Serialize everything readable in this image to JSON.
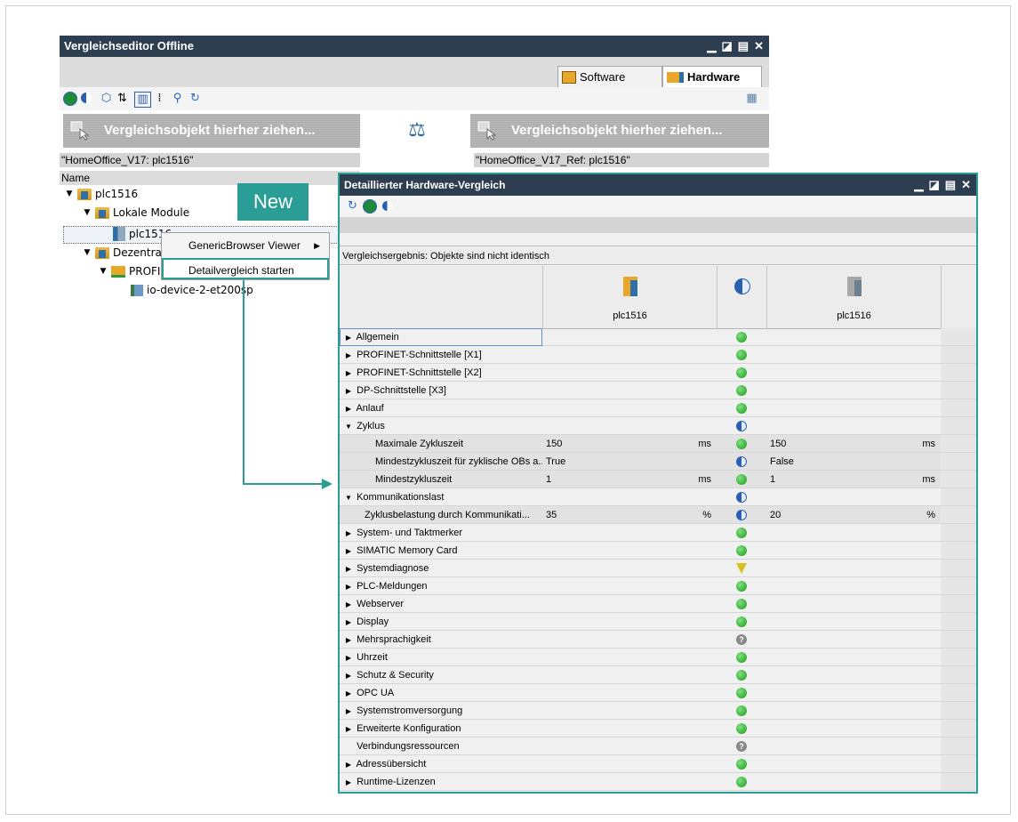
{
  "editor": {
    "title": "Vergleichseditor Offline",
    "tabs": [
      {
        "label": "Software"
      },
      {
        "label": "Hardware"
      }
    ],
    "dropzone_left": "Vergleichsobjekt hierher ziehen...",
    "dropzone_right": "Vergleichsobjekt hierher ziehen...",
    "path_left": "\"HomeOffice_V17: plc1516\"",
    "path_right": "\"HomeOffice_V17_Ref: plc1516\"",
    "tree_header": "Name",
    "tree": [
      {
        "label": "plc1516"
      },
      {
        "label": "Lokale Module"
      },
      {
        "label": "plc1516"
      },
      {
        "label": "Dezentra"
      },
      {
        "label": "PROFI"
      },
      {
        "label": "io-device-2-et200sp"
      }
    ]
  },
  "badge": {
    "label": "New"
  },
  "context_menu": {
    "items": [
      {
        "label": "GenericBrowser Viewer"
      },
      {
        "label": "Detailvergleich starten"
      }
    ]
  },
  "detail": {
    "title": "Detaillierter Hardware-Vergleich",
    "status": "Vergleichsergebnis: Objekte sind nicht identisch",
    "left_name": "plc1516",
    "right_name": "plc1516",
    "rows": [
      {
        "name": "Allgemein",
        "exp": "▶",
        "status": "equal"
      },
      {
        "name": "PROFINET-Schnittstelle [X1]",
        "exp": "▶",
        "status": "equal"
      },
      {
        "name": "PROFINET-Schnittstelle [X2]",
        "exp": "▶",
        "status": "equal"
      },
      {
        "name": "DP-Schnittstelle [X3]",
        "exp": "▶",
        "status": "equal"
      },
      {
        "name": "Anlauf",
        "exp": "▶",
        "status": "equal"
      },
      {
        "name": "Zyklus",
        "exp": "▼",
        "status": "diff"
      },
      {
        "name": "Maximale Zykluszeit",
        "indent": 2,
        "status": "equal",
        "left": "150",
        "left_unit": "ms",
        "right": "150",
        "right_unit": "ms"
      },
      {
        "name": "Mindestzykluszeit für zyklische OBs a...",
        "indent": 2,
        "status": "diff",
        "left": "True",
        "right": "False"
      },
      {
        "name": "Mindestzykluszeit",
        "indent": 2,
        "status": "equal",
        "left": "1",
        "left_unit": "ms",
        "right": "1",
        "right_unit": "ms"
      },
      {
        "name": "Kommunikationslast",
        "exp": "▼",
        "status": "diff"
      },
      {
        "name": "Zyklusbelastung durch Kommunikati...",
        "indent": 1,
        "status": "diff",
        "left": "35",
        "left_unit": "%",
        "right": "20",
        "right_unit": "%"
      },
      {
        "name": "System- und Taktmerker",
        "exp": "▶",
        "status": "equal"
      },
      {
        "name": "SIMATIC Memory Card",
        "exp": "▶",
        "status": "equal"
      },
      {
        "name": "Systemdiagnose",
        "exp": "▶",
        "status": "filter"
      },
      {
        "name": "PLC-Meldungen",
        "exp": "▶",
        "status": "equal"
      },
      {
        "name": "Webserver",
        "exp": "▶",
        "status": "equal"
      },
      {
        "name": "Display",
        "exp": "▶",
        "status": "equal"
      },
      {
        "name": "Mehrsprachigkeit",
        "exp": "▶",
        "status": "unknown"
      },
      {
        "name": "Uhrzeit",
        "exp": "▶",
        "status": "equal"
      },
      {
        "name": "Schutz & Security",
        "exp": "▶",
        "status": "equal"
      },
      {
        "name": "OPC UA",
        "exp": "▶",
        "status": "equal"
      },
      {
        "name": "Systemstromversorgung",
        "exp": "▶",
        "status": "equal"
      },
      {
        "name": "Erweiterte Konfiguration",
        "exp": "▶",
        "status": "equal"
      },
      {
        "name": "Verbindungsressourcen",
        "exp": "",
        "status": "unknown"
      },
      {
        "name": "Adressübersicht",
        "exp": "▶",
        "status": "equal"
      },
      {
        "name": "Runtime-Lizenzen",
        "exp": "▶",
        "status": "equal"
      }
    ]
  },
  "colors": {
    "accent": "#2a9d96",
    "titlebar": "#2d3e50",
    "equal": "#22a022",
    "diff": "#2a5fb0"
  }
}
